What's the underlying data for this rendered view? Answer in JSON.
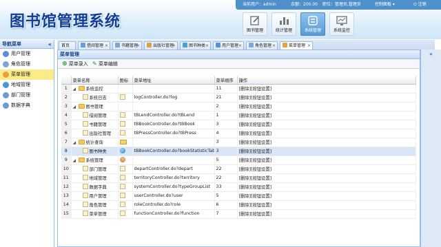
{
  "app": {
    "title": "图书馆管理系统"
  },
  "topbar": {
    "user_label": "当前用户：admin",
    "balance": "余额：200.00",
    "role": "职位：管理员,管理员",
    "control_panel": "控制面板",
    "logout": "注销"
  },
  "modules": [
    {
      "label": "图书管理",
      "icon": "edit-icon"
    },
    {
      "label": "统计管理",
      "icon": "bar-chart-icon"
    },
    {
      "label": "系统管理",
      "icon": "settings-icon"
    },
    {
      "label": "系统监控",
      "icon": "monitor-icon"
    }
  ],
  "sidebar": {
    "title": "导航菜单",
    "items": [
      {
        "label": "用户管理",
        "icon": "user-icon",
        "color": "#5b8fd6"
      },
      {
        "label": "角色管理",
        "icon": "role-icon",
        "color": "#7aa6d8"
      },
      {
        "label": "菜单管理",
        "icon": "menu-icon",
        "color": "#e9a23b"
      },
      {
        "label": "地域管理",
        "icon": "globe-icon",
        "color": "#3f9ad6"
      },
      {
        "label": "部门管理",
        "icon": "dept-icon",
        "color": "#6b9bd2"
      },
      {
        "label": "数据字典",
        "icon": "dict-icon",
        "color": "#6b9bd2"
      }
    ]
  },
  "tabs": [
    {
      "label": "首页"
    },
    {
      "label": "借阅管理"
    },
    {
      "label": "书籍管理"
    },
    {
      "label": "出版社管理"
    },
    {
      "label": "图书种类"
    },
    {
      "label": "用户管理"
    },
    {
      "label": "角色管理"
    },
    {
      "label": "菜单管理"
    }
  ],
  "panel": {
    "title": "菜单管理",
    "add_label": "菜单录入",
    "edit_label": "菜单编辑"
  },
  "grid": {
    "columns": [
      "菜单名称",
      "图标",
      "菜单地址",
      "菜单顺序",
      "操作"
    ],
    "rows": [
      {
        "n": "1",
        "name": "系统监控",
        "type": "folder",
        "level": 1,
        "icon": "",
        "url": "",
        "order": "11",
        "op": "[删除][按钮设置]"
      },
      {
        "n": "2",
        "name": "系统日志",
        "type": "leaf",
        "level": 2,
        "icon": "doc",
        "url": "logController.do?log",
        "order": "21",
        "op": "[删除][按钮设置]"
      },
      {
        "n": "3",
        "name": "图书管理",
        "type": "folder",
        "level": 1,
        "icon": "",
        "url": "",
        "order": "2",
        "op": "[删除][按钮设置]"
      },
      {
        "n": "4",
        "name": "借阅管理",
        "type": "leaf",
        "level": 2,
        "icon": "doc",
        "url": "tBLendController.do?tBLend",
        "order": "1",
        "op": "[删除][按钮设置]"
      },
      {
        "n": "5",
        "name": "书籍管理",
        "type": "leaf",
        "level": 2,
        "icon": "doc",
        "url": "tBBookController.do?tBBook",
        "order": "3",
        "op": "[删除][按钮设置]"
      },
      {
        "n": "6",
        "name": "出版社管理",
        "type": "leaf",
        "level": 2,
        "icon": "doc",
        "url": "tBPressController.do?tBPress",
        "order": "4",
        "op": "[删除][按钮设置]"
      },
      {
        "n": "7",
        "name": "统计查询",
        "type": "folder",
        "level": 1,
        "icon": "folder",
        "url": "",
        "order": "3",
        "op": "[删除][按钮设置]"
      },
      {
        "n": "8",
        "name": "图书种类",
        "type": "leaf",
        "level": 2,
        "icon": "globe",
        "url": "tBBookController.do?bookStatisticTabs",
        "order": "3",
        "op": "[删除][按钮设置]"
      },
      {
        "n": "9",
        "name": "系统管理",
        "type": "folder",
        "level": 1,
        "icon": "group",
        "url": "",
        "order": "5",
        "op": "[删除][按钮设置]"
      },
      {
        "n": "10",
        "name": "部门管理",
        "type": "leaf",
        "level": 2,
        "icon": "doc",
        "url": "departController.do?depart",
        "order": "22",
        "op": "[删除][按钮设置]"
      },
      {
        "n": "11",
        "name": "地域管理",
        "type": "leaf",
        "level": 2,
        "icon": "doc",
        "url": "territoryController.do?territory",
        "order": "22",
        "op": "[删除][按钮设置]"
      },
      {
        "n": "12",
        "name": "数据字典",
        "type": "leaf",
        "level": 2,
        "icon": "doc",
        "url": "systemController.do?typeGroupList",
        "order": "33",
        "op": "[删除][按钮设置]"
      },
      {
        "n": "13",
        "name": "用户管理",
        "type": "leaf",
        "level": 2,
        "icon": "doc",
        "url": "userController.do?user",
        "order": "5",
        "op": "[删除][按钮设置]"
      },
      {
        "n": "14",
        "name": "角色管理",
        "type": "leaf",
        "level": 2,
        "icon": "doc",
        "url": "roleController.do?role",
        "order": "6",
        "op": "[删除][按钮设置]"
      },
      {
        "n": "15",
        "name": "菜单管理",
        "type": "leaf",
        "level": 2,
        "icon": "doc",
        "url": "functionController.do?function",
        "order": "7",
        "op": "[删除][按钮设置]"
      }
    ]
  }
}
